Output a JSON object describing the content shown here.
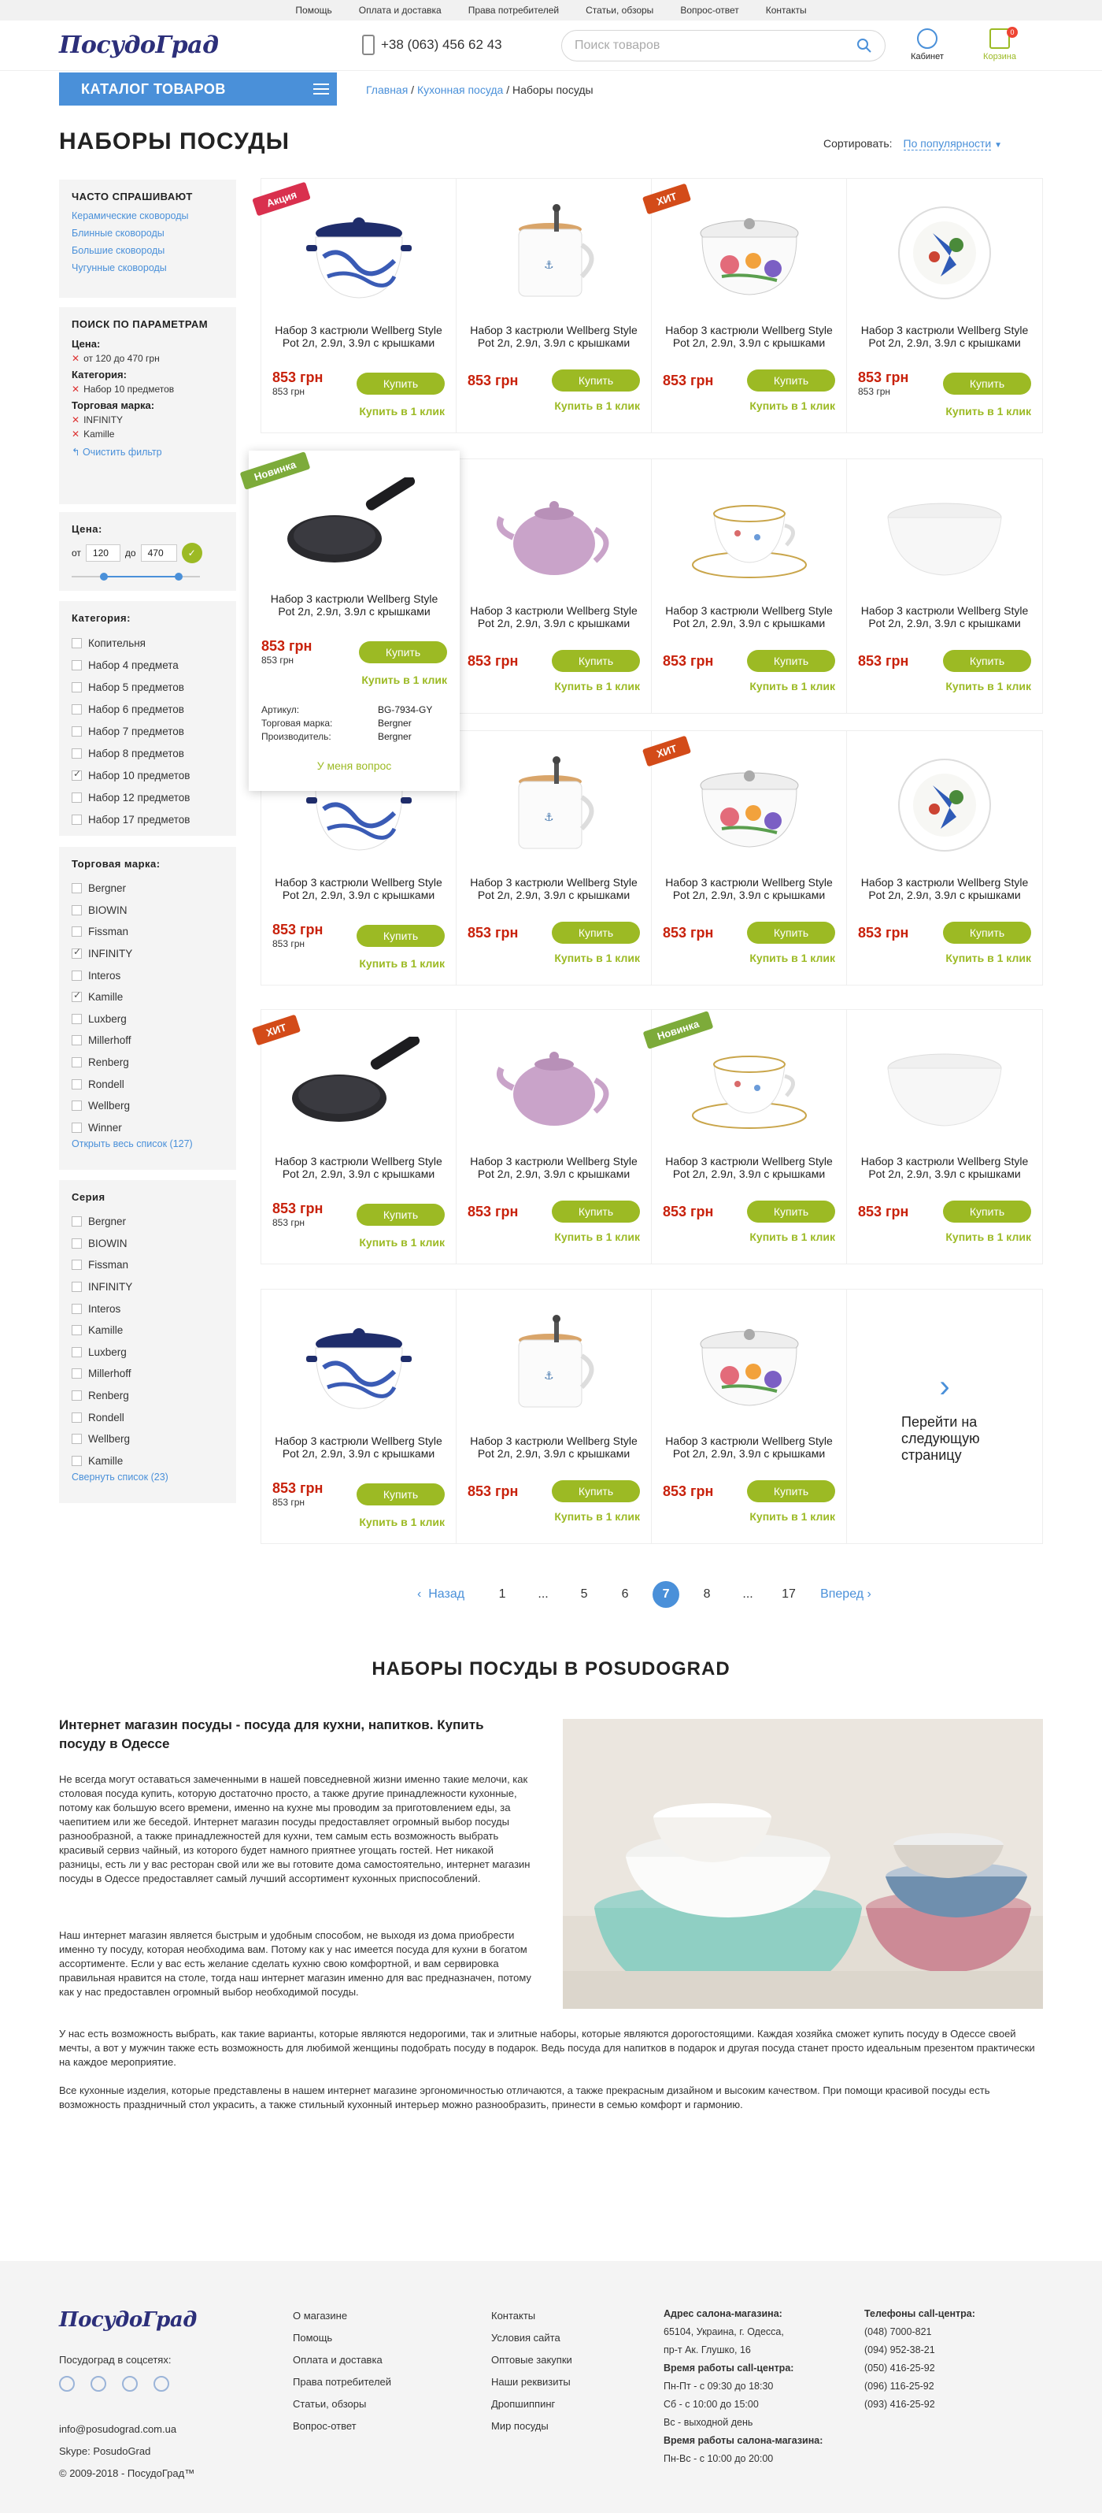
{
  "topnav": [
    "Помощь",
    "Оплата и доставка",
    "Права потребителей",
    "Статьи, обзоры",
    "Вопрос-ответ",
    "Контакты"
  ],
  "header": {
    "logo": "ПосудоГрад",
    "phone": "+38 (063) 456 62 43",
    "search_placeholder": "Поиск товаров",
    "cabinet": "Кабинет",
    "cart": "Корзина",
    "cart_count": "0"
  },
  "catalog_label": "КАТАЛОГ ТОВАРОВ",
  "breadcrumb": {
    "home": "Главная",
    "cat": "Кухонная посуда",
    "current": "Наборы посуды"
  },
  "page_title": "НАБОРЫ ПОСУДЫ",
  "sort": {
    "label": "Сортировать:",
    "value": "По популярности"
  },
  "faq": {
    "title": "ЧАСТО СПРАШИВАЮТ",
    "links": [
      "Керамические сковороды",
      "Блинные сковороды",
      "Большие сковороды",
      "Чугунные сковороды"
    ]
  },
  "params": {
    "title": "ПОИСК ПО ПАРАМЕТРАМ",
    "price_lbl": "Цена:",
    "price_val": "от 120 до 470 грн",
    "cat_lbl": "Категория:",
    "cat_val": "Набор 10 предметов",
    "brand_lbl": "Торговая марка:",
    "brand_vals": [
      "INFINITY",
      "Kamille"
    ],
    "clear": "Очистить фильтр"
  },
  "price": {
    "title": "Цена:",
    "from_lbl": "от",
    "from": "120",
    "to_lbl": "до",
    "to": "470"
  },
  "category": {
    "title": "Категория:",
    "items": [
      [
        "Копительня",
        false
      ],
      [
        "Набор 4 предмета",
        false
      ],
      [
        "Набор 5 предметов",
        false
      ],
      [
        "Набор 6 предметов",
        false
      ],
      [
        "Набор 7 предметов",
        false
      ],
      [
        "Набор 8 предметов",
        false
      ],
      [
        "Набор 10 предметов",
        true
      ],
      [
        "Набор 12 предметов",
        false
      ],
      [
        "Набор 17 предметов",
        false
      ]
    ]
  },
  "brand": {
    "title": "Торговая марка:",
    "items": [
      [
        "Bergner",
        false
      ],
      [
        "BIOWIN",
        false
      ],
      [
        "Fissman",
        false
      ],
      [
        "INFINITY",
        true
      ],
      [
        "Interos",
        false
      ],
      [
        "Kamille",
        true
      ],
      [
        "Luxberg",
        false
      ],
      [
        "Millerhoff",
        false
      ],
      [
        "Renberg",
        false
      ],
      [
        "Rondell",
        false
      ],
      [
        "Wellberg",
        false
      ],
      [
        "Winner",
        false
      ]
    ],
    "more": "Открыть весь список (127)"
  },
  "series": {
    "title": "Серия",
    "items": [
      "Bergner",
      "BIOWIN",
      "Fissman",
      "INFINITY",
      "Interos",
      "Kamille",
      "Luxberg",
      "Millerhoff",
      "Renberg",
      "Rondell",
      "Wellberg",
      "Kamille"
    ],
    "less": "Свернуть список (23)"
  },
  "product": {
    "title": "Набор 3 кастрюли Wellberg Style Pot 2л, 2.9л, 3.9л с крышками",
    "price": "853 грн",
    "old": "853 грн",
    "buy": "Купить",
    "oneclick": "Купить в 1 клик"
  },
  "tags": {
    "sale": "Акция",
    "hit": "ХИТ",
    "new": "Новинка"
  },
  "popup": {
    "art_k": "Артикул:",
    "art_v": "BG-7934-GY",
    "brand_k": "Торговая марка:",
    "brand_v": "Bergner",
    "maker_k": "Производитель:",
    "maker_v": "Bergner",
    "ask": "У меня вопрос"
  },
  "next_page": "Перейти на следующую страницу",
  "pager": {
    "prev": "Назад",
    "pages": [
      "1",
      "...",
      "5",
      "6",
      "7",
      "8",
      "...",
      "17"
    ],
    "next": "Вперед"
  },
  "seo": {
    "title": "НАБОРЫ ПОСУДЫ В POSUDOGRAD",
    "heading": "Интернет магазин посуды - посуда для кухни, напитков. Купить посуду в Одессе",
    "p1": "Не всегда могут оставаться замеченными в нашей повседневной жизни именно такие мелочи, как столовая посуда купить, которую достаточно просто, а также другие принадлежности кухонные, потому как большую всего времени, именно на кухне мы проводим за приготовлением еды, за чаепитием или же беседой. Интернет магазин посуды предоставляет огромный выбор посуды разнообразной, а также принадлежностей для кухни, тем самым есть возможность выбрать красивый сервиз чайный, из которого будет намного приятнее угощать гостей. Нет никакой разницы, есть ли у вас ресторан свой или же вы готовите дома самостоятельно, интернет магазин посуды в Одессе предоставляет самый лучший ассортимент кухонных приспособлений.",
    "p2": "Наш интернет магазин является быстрым и удобным способом, не выходя из дома приобрести именно ту посуду, которая необходима вам. Потому как у нас имеется посуда для кухни в богатом ассортименте. Если у вас есть желание сделать кухню свою комфортной, и вам сервировка правильная нравится на столе, тогда наш интернет магазин именно для вас предназначен, потому как у нас предоставлен огромный выбор необходимой посуды.",
    "p3": "У нас есть возможность выбрать, как такие варианты, которые являются недорогими, так и элитные наборы, которые являются дорогостоящими. Каждая хозяйка сможет купить посуду в Одессе своей мечты, а вот у мужчин также есть возможность для любимой женщины подобрать посуду в подарок. Ведь посуда для напитков в подарок и другая посуда станет просто идеальным презентом практически на каждое мероприятие.",
    "p4": "Все кухонные изделия, которые представлены в нашем интернет магазине эргономичностью отличаются, а также прекрасным дизайном и высоким качеством. При помощи красивой посуды есть возможность праздничный стол украсить, а также стильный кухонный интерьер можно разнообразить, принести в семью комфорт и гармонию."
  },
  "footer": {
    "social": "Посудоград в соцсетях:",
    "email": "info@posudograd.com.ua",
    "skype": "Skype: PosudoGrad",
    "copy": "© 2009-2018 - ПосудоГрад™",
    "col1": [
      "О магазине",
      "Помощь",
      "Оплата и доставка",
      "Права потребителей",
      "Статьи, обзоры",
      "Вопрос-ответ"
    ],
    "col2": [
      "Контакты",
      "Условия сайта",
      "Оптовые закупки",
      "Наши реквизиты",
      "Дропшиппинг",
      "Мир посуды"
    ],
    "addr_t": "Адрес салона-магазина:",
    "addr": [
      "65104, Украина, г. Одесса,",
      "пр-т Ак. Глушко, 16"
    ],
    "work_t": "Время работы call-центра:",
    "work": [
      "Пн-Пт - с 09:30 до 18:30",
      "Сб - с 10:00 до 15:00",
      "Вс - выходной день"
    ],
    "salon_t": "Время работы салона-магазина:",
    "salon": [
      "Пн-Вс - с 10:00 до 20:00"
    ],
    "phones_t": "Телефоны call-центра:",
    "phones": [
      "(048) 7000-821",
      "(094) 952-38-21",
      "(050) 416-25-92",
      "(096) 116-25-92",
      "(093) 416-25-92"
    ]
  }
}
